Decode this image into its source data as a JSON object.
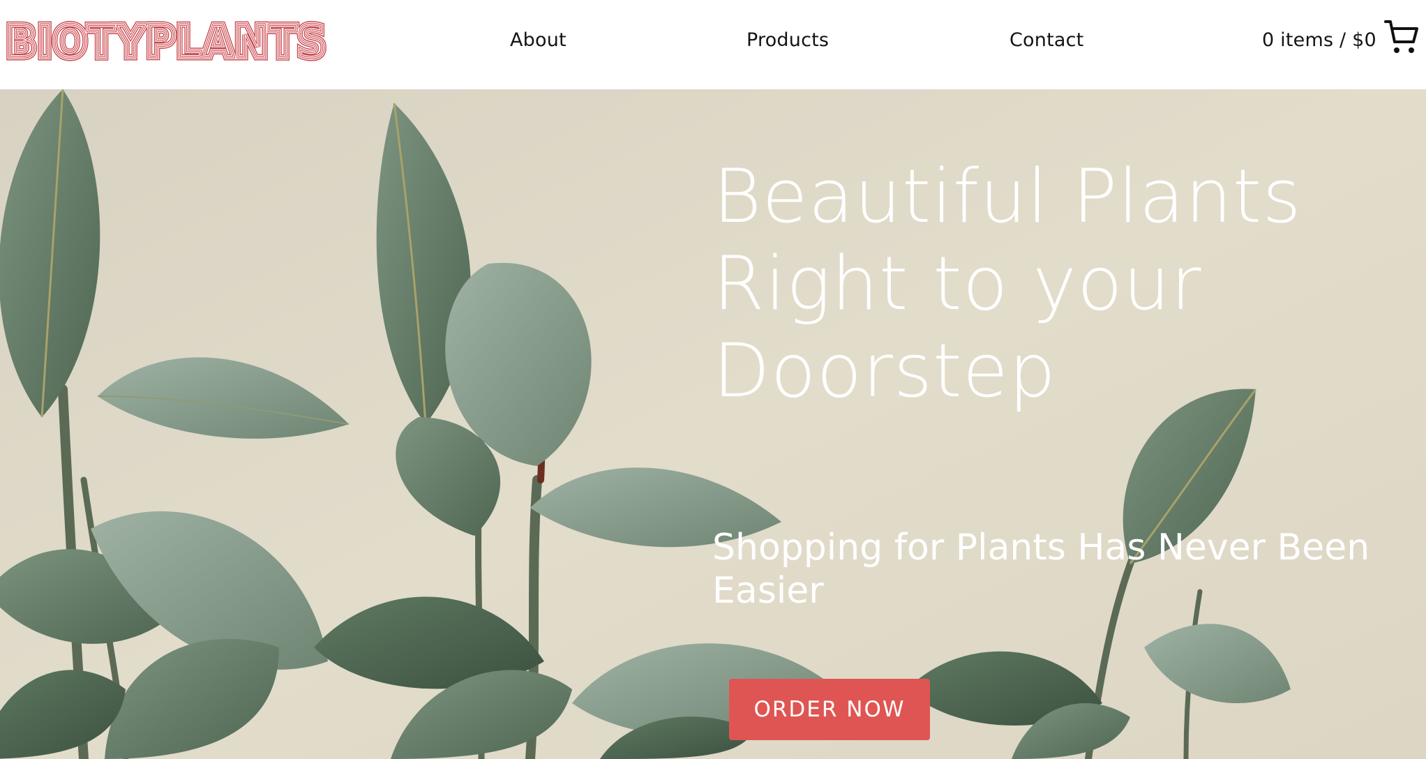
{
  "brand": {
    "logo_text": "BIOTYPLANTS",
    "logo_color": "#c9474d"
  },
  "nav": {
    "items": [
      {
        "label": "About"
      },
      {
        "label": "Products"
      },
      {
        "label": "Contact"
      }
    ],
    "cart_summary": "0 items / $0",
    "cart_icon": "shopping-cart-icon"
  },
  "hero": {
    "title_lines": [
      "Beautiful Plants",
      "Right to your",
      "Doorstep"
    ],
    "subtitle": "Shopping for Plants Has Never Been Easier",
    "cta_label": "ORDER NOW",
    "cta_color": "#df5553",
    "background_image": "rubber-plant-leaves-photo"
  }
}
